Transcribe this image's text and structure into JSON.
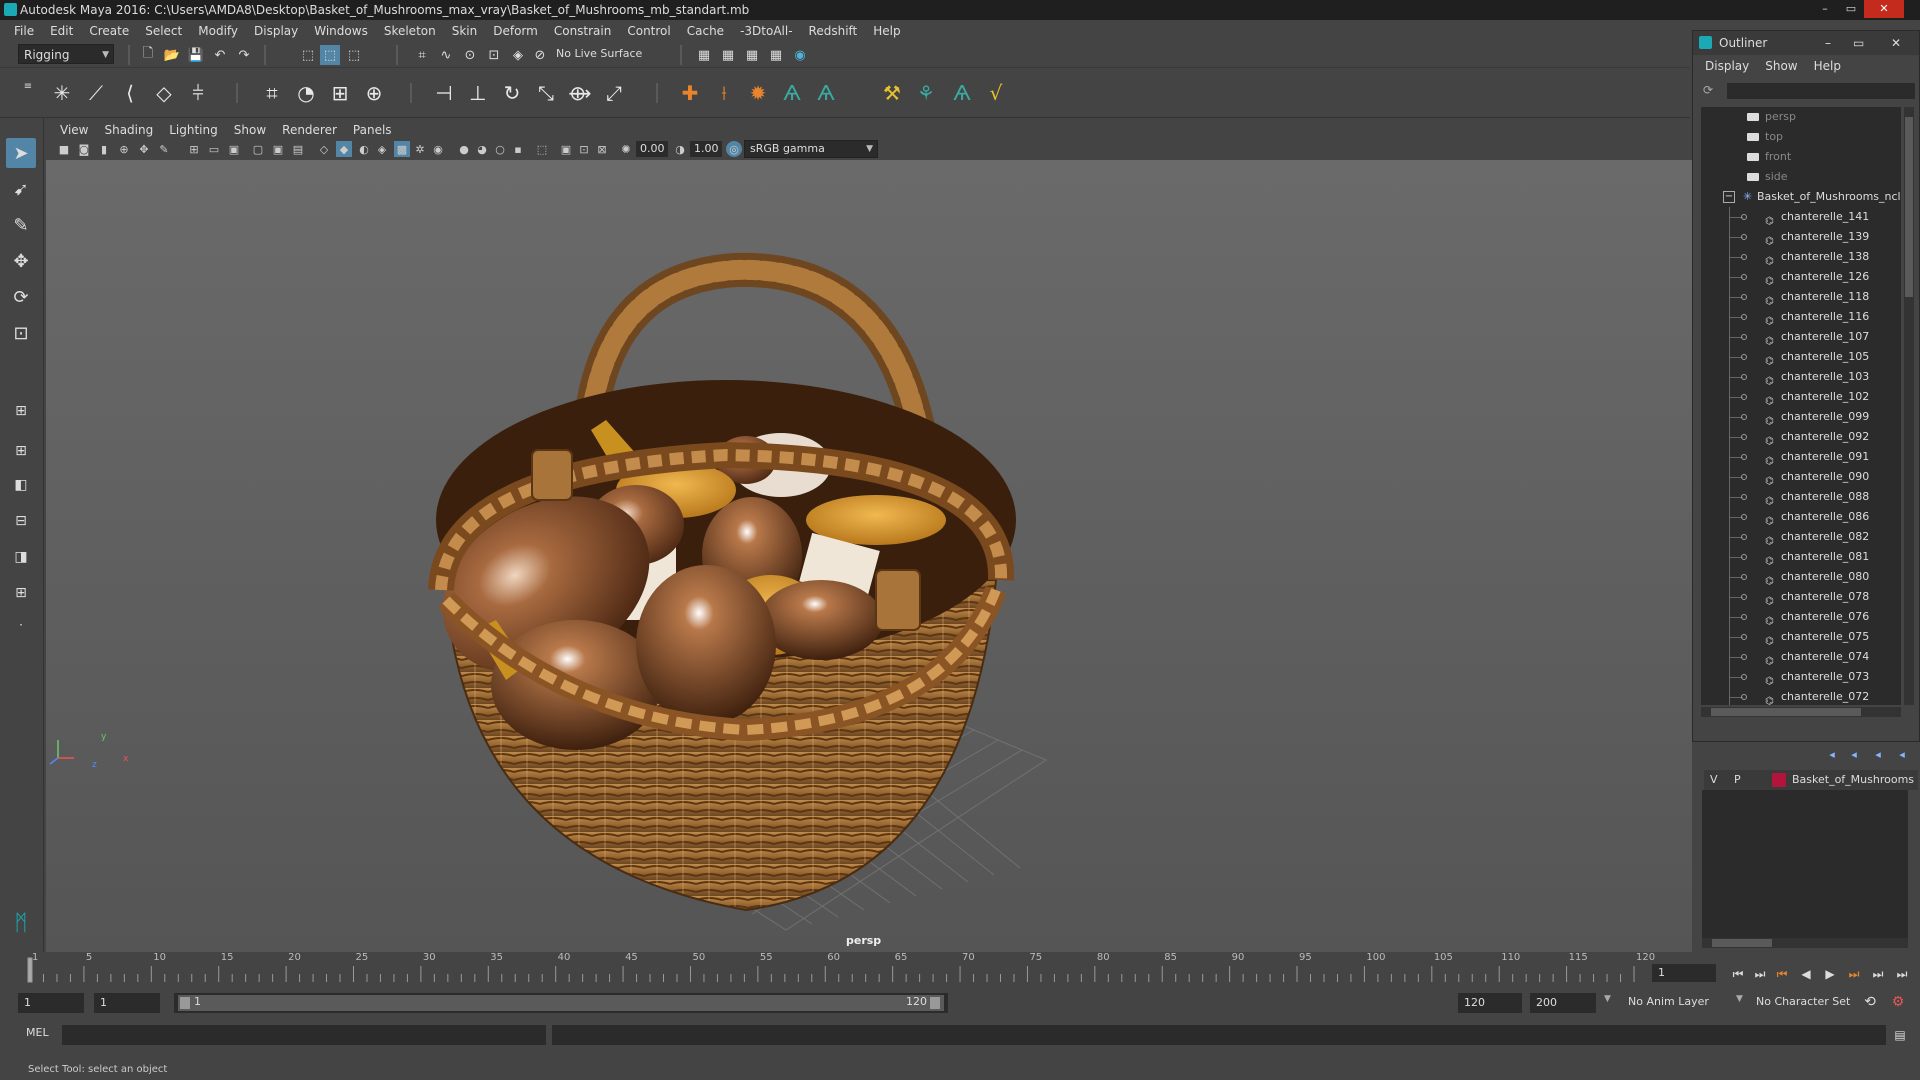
{
  "window": {
    "title": "Autodesk Maya 2016: C:\\Users\\AMDA8\\Desktop\\Basket_of_Mushrooms_max_vray\\Basket_of_Mushrooms_mb_standart.mb",
    "minimize": "–",
    "maximize": "▭",
    "close": "✕"
  },
  "menubar": [
    "File",
    "Edit",
    "Create",
    "Select",
    "Modify",
    "Display",
    "Windows",
    "Skeleton",
    "Skin",
    "Deform",
    "Constrain",
    "Control",
    "Cache",
    "-3DtoAll-",
    "Redshift",
    "Help"
  ],
  "shelf": {
    "mode": "Rigging",
    "live_surface": "No Live Surface"
  },
  "viewport": {
    "menus": [
      "View",
      "Shading",
      "Lighting",
      "Show",
      "Renderer",
      "Panels"
    ],
    "exposure": "0.00",
    "gamma": "1.00",
    "color_space": "sRGB gamma",
    "camera_label": "persp",
    "axis_x": "x",
    "axis_y": "y",
    "axis_z": "z"
  },
  "outliner": {
    "title": "Outliner",
    "menus": [
      "Display",
      "Show",
      "Help"
    ],
    "cameras": [
      "persp",
      "top",
      "front",
      "side"
    ],
    "group": "Basket_of_Mushrooms_ncl",
    "group_toggle": "−",
    "items": [
      "chanterelle_141",
      "chanterelle_139",
      "chanterelle_138",
      "chanterelle_126",
      "chanterelle_118",
      "chanterelle_116",
      "chanterelle_107",
      "chanterelle_105",
      "chanterelle_103",
      "chanterelle_102",
      "chanterelle_099",
      "chanterelle_092",
      "chanterelle_091",
      "chanterelle_090",
      "chanterelle_088",
      "chanterelle_086",
      "chanterelle_082",
      "chanterelle_081",
      "chanterelle_080",
      "chanterelle_078",
      "chanterelle_076",
      "chanterelle_075",
      "chanterelle_074",
      "chanterelle_073",
      "chanterelle_072"
    ]
  },
  "layers": {
    "visible": "V",
    "playback": "P",
    "layer_name": "Basket_of_Mushrooms",
    "layer_color": "#b3143c"
  },
  "timeline": {
    "ticks": [
      "1",
      "5",
      "10",
      "15",
      "20",
      "25",
      "30",
      "35",
      "40",
      "45",
      "50",
      "55",
      "60",
      "65",
      "70",
      "75",
      "80",
      "85",
      "90",
      "95",
      "100",
      "105",
      "110",
      "115",
      "120"
    ],
    "current_frame": "1"
  },
  "range": {
    "start": "1",
    "playback_start": "1",
    "slider_start": "1",
    "slider_end": "120",
    "playback_end": "120",
    "end": "200",
    "anim_layer": "No Anim Layer",
    "character_set": "No Character Set"
  },
  "cmdline": {
    "label": "MEL"
  },
  "status": {
    "text": "Select Tool: select an object"
  },
  "colors": {
    "accent": "#5285a6",
    "maya_teal": "#1aa9b5"
  }
}
